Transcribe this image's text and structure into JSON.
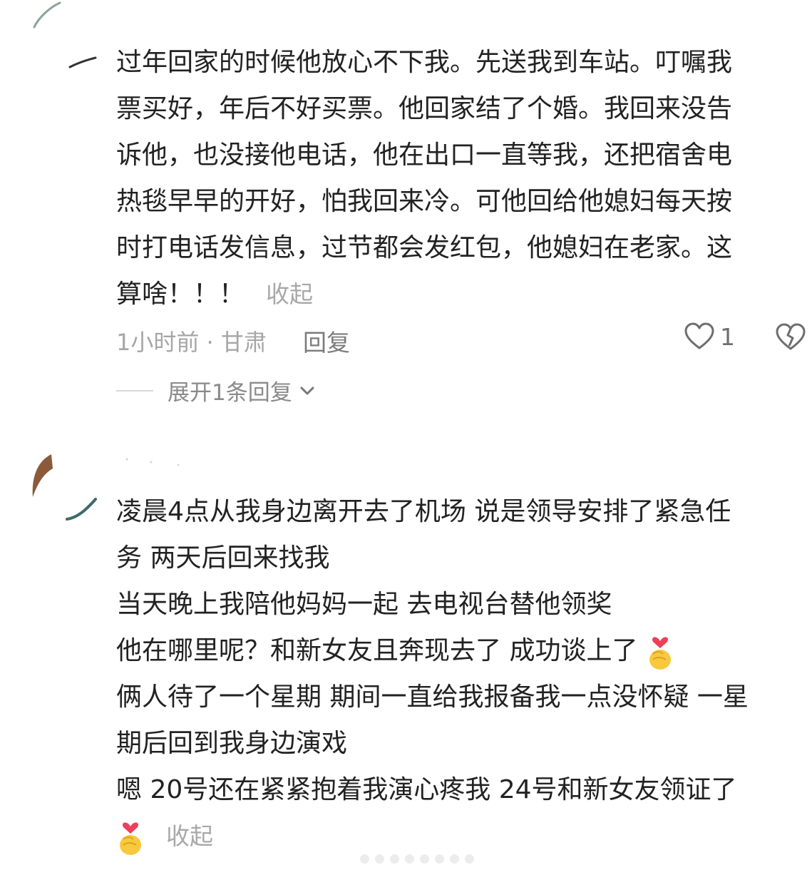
{
  "comment1": {
    "lines": [
      "过年回家的时候他放心不下我。先送我到车站。叮嘱我",
      "票买好，年后不好买票。他回家结了个婚。我回来没告",
      "诉他，也没接他电话，他在出口一直等我，还把宿舍电",
      "热毯早早的开好，怕我回来冷。可他回给他媳妇每天按",
      "时打电话发信息，过节都会发红包，他媳妇在老家。这",
      "算啥！！！"
    ],
    "collapse_label": "收起",
    "time_location": "1小时前 · 甘肃",
    "reply_label": "回复",
    "like_count": "1",
    "expand_label": "展开1条回复"
  },
  "comment2": {
    "lines": [
      "凌晨4点从我身边离开去了机场 说是领导安排了紧急任",
      "务 两天后回来找我",
      "当天晚上我陪他妈妈一起 去电视台替他领奖",
      "他在哪里呢？和新女友且奔现去了 成功谈上了",
      "俩人待了一个星期 期间一直给我报备我一点没怀疑 一星",
      "期后回到我身边演戏",
      "嗯 20号还在紧紧抱着我演心疼我 24号和新女友领证了"
    ],
    "collapse_label": "收起"
  },
  "icons": {
    "like": "heart-outline-icon",
    "dislike": "broken-heart-icon",
    "expand": "chevron-down-icon",
    "emoji": "finger-heart-emoji"
  }
}
